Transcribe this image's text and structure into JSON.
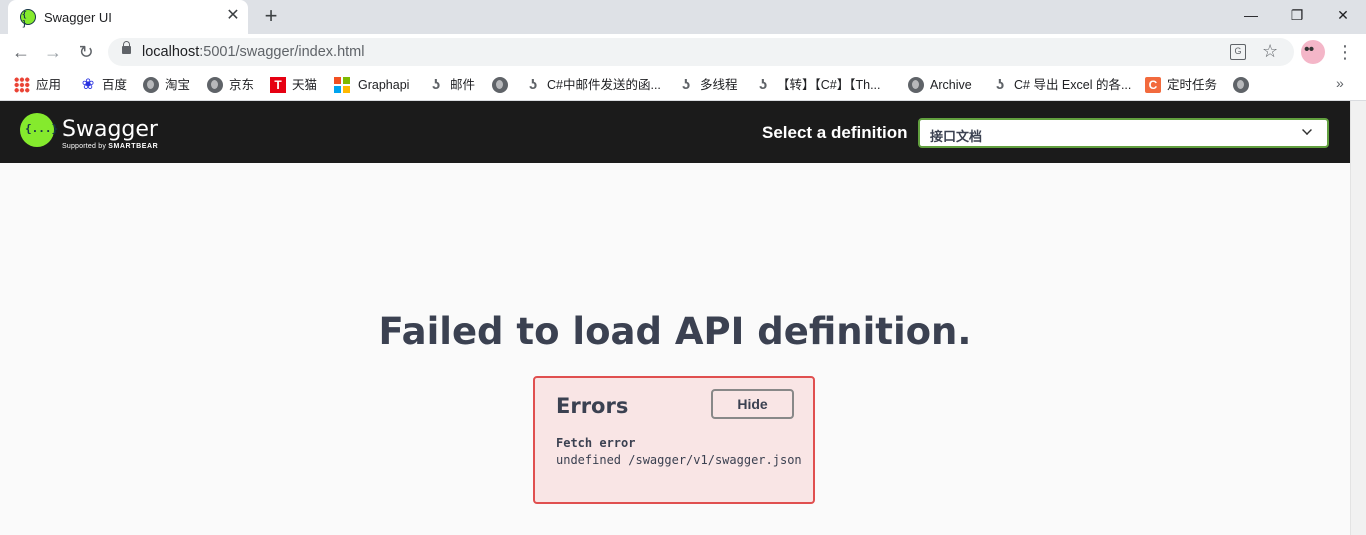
{
  "tab": {
    "title": "Swagger UI",
    "close": "✕",
    "new_tab": "+"
  },
  "window": {
    "minimize": "—",
    "restore": "❐",
    "close": "✕"
  },
  "toolbar": {
    "back": "←",
    "forward": "→",
    "reload": "↻",
    "url_host": "localhost",
    "url_rest": ":5001/swagger/index.html",
    "star": "☆",
    "menu": "⋮"
  },
  "bookmarks": [
    {
      "label": "应用",
      "icon": "apps-icon"
    },
    {
      "label": "百度",
      "icon": "baidu-paw-icon"
    },
    {
      "label": "淘宝",
      "icon": "globe-icon"
    },
    {
      "label": "京东",
      "icon": "globe-icon"
    },
    {
      "label": "天猫",
      "icon": "tmall-icon"
    },
    {
      "label": "Graphapi",
      "icon": "microsoft-icon"
    },
    {
      "label": "邮件",
      "icon": "yuque-icon"
    },
    {
      "label": "",
      "icon": "globe-icon"
    },
    {
      "label": "C#中邮件发送的函...",
      "icon": "yuque-icon"
    },
    {
      "label": "多线程",
      "icon": "yuque-icon"
    },
    {
      "label": "【转】【C#】【Th...",
      "icon": "yuque-icon"
    },
    {
      "label": "Archive",
      "icon": "globe-icon"
    },
    {
      "label": "C# 导出 Excel 的各...",
      "icon": "yuque-icon"
    },
    {
      "label": "定时任务",
      "icon": "c-icon"
    },
    {
      "label": "",
      "icon": "globe-icon"
    }
  ],
  "bookmarks_more": "»",
  "swagger": {
    "brand": "Swagger",
    "supported_by": "Supported by",
    "smartbear": "SMARTBEAR",
    "select_label": "Select a definition",
    "selected_definition": "接口文档"
  },
  "error": {
    "title": "Failed to load API definition.",
    "box_title": "Errors",
    "hide_label": "Hide",
    "line1": "Fetch error",
    "line2": "undefined /swagger/v1/swagger.json"
  },
  "colors": {
    "header_bg": "#1b1b1b",
    "swagger_green": "#85ea2d",
    "select_border": "#62a03f",
    "error_border": "#e04f4f",
    "error_bg": "#f9e5e5",
    "text_dark": "#3b4151"
  }
}
